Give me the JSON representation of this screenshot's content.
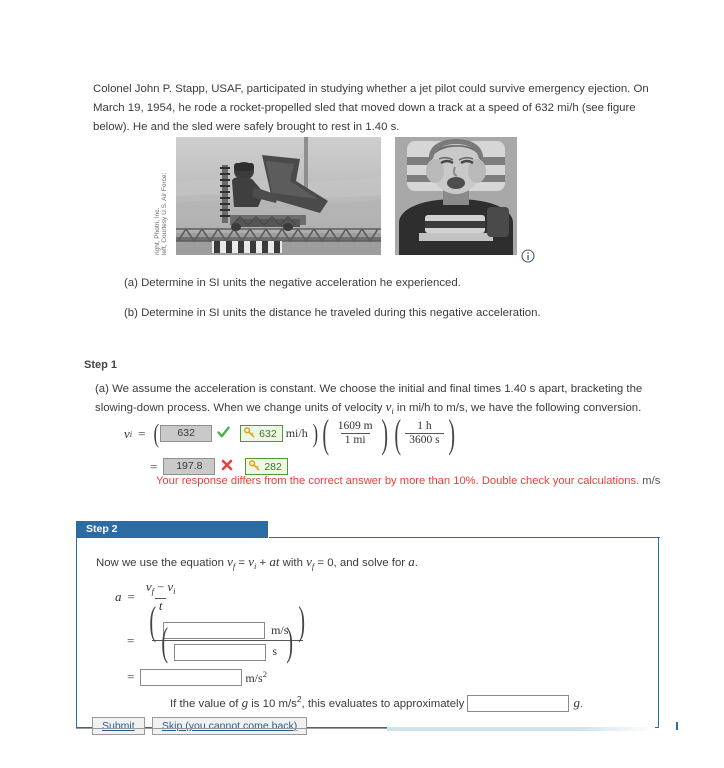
{
  "problem": {
    "intro": "Colonel John P. Stapp, USAF, participated in studying whether a jet pilot could survive emergency ejection. On March 19, 1954, he rode a rocket-propelled sled that moved down a track at a speed of 632 mi/h (see figure below). He and the sled were safely brought to rest in 1.40 s.",
    "part_a": "(a) Determine in SI units the negative acceleration he experienced.",
    "part_b": "(b) Determine in SI units the distance he traveled during this negative acceleration."
  },
  "figure": {
    "credit_line1": "left, Courtesy U.S. Air Force;",
    "credit_line2": "right, Photri, Inc.",
    "info_icon": "info-icon",
    "left_photo_alt": "rocket-propelled sled on track",
    "right_photo_alt": "pilot face under deceleration"
  },
  "step1": {
    "label": "Step 1",
    "text": "(a) We assume the acceleration is constant. We choose the initial and final times 1.40 s apart, bracketing the slowing-down process. When we change units of velocity v_i in mi/h to m/s, we have the following conversion.",
    "text_part1": "(a) We assume the acceleration is constant. We choose the initial and final times 1.40 s apart, bracketing the",
    "text_part2_pre": "slowing-down process. When we change units of velocity ",
    "text_part2_var": "v",
    "text_part2_sub": "i",
    "text_part2_post": " in mi/h to m/s, we have the following conversion.",
    "lhs_var": "v",
    "lhs_sub": "i",
    "eq": "=",
    "user_answer_1": "632",
    "user_answer_1_status": "correct",
    "key_answer_1": "632",
    "unit_mih": "mi/h",
    "conv1_num": "1609 m",
    "conv1_den": "1 mi",
    "conv2_num": "1 h",
    "conv2_den": "3600 s",
    "user_answer_2": "197.8",
    "user_answer_2_status": "incorrect",
    "key_answer_2": "282",
    "error_message": "Your response differs from the correct answer by more than 10%. Double check your calculations.",
    "error_unit": "m/s",
    "check_icon": "check-icon",
    "x_icon": "x-icon",
    "key_icon": "key-icon"
  },
  "step2": {
    "label": "Step 2",
    "intro_pre": "Now we use the equation ",
    "intro_vf": "v",
    "intro_vf_sub": "f",
    "intro_eq1": " = ",
    "intro_vi": "v",
    "intro_vi_sub": "i",
    "intro_plus": " + ",
    "intro_at": "at",
    "intro_with": " with ",
    "intro_vf2": "v",
    "intro_vf2_sub": "f",
    "intro_zero": " = 0, and solve for ",
    "intro_a": "a",
    "intro_end": ".",
    "a_var": "a",
    "eq": "=",
    "frac_num_vf": "v",
    "frac_num_vf_sub": "f",
    "frac_minus": " − ",
    "frac_num_vi": "v",
    "frac_num_vi_sub": "i",
    "frac_den_t": "t",
    "input_ms_unit": "m/s",
    "input_s_unit": "s",
    "input_ms2_unit": "m/s",
    "input_ms2_sup": "2",
    "input_top_value": "",
    "input_bottom_value": "",
    "input_result_value": "",
    "input_g_value": "",
    "g_line_pre": "If the value of ",
    "g_line_var": "g",
    "g_line_mid": " is 10 m/s",
    "g_line_sup": "2",
    "g_line_post": ", this evaluates to approximately ",
    "g_line_unit": "g",
    "g_line_end": ".",
    "submit_label": "Submit",
    "skip_label": "Skip (you cannot come back)"
  },
  "colors": {
    "step_header_blue": "#2d6ca2",
    "correct_green": "#4e9a2f",
    "error_red": "#e8413a",
    "key_gold": "#e8b923",
    "text": "#3b3b3b"
  }
}
